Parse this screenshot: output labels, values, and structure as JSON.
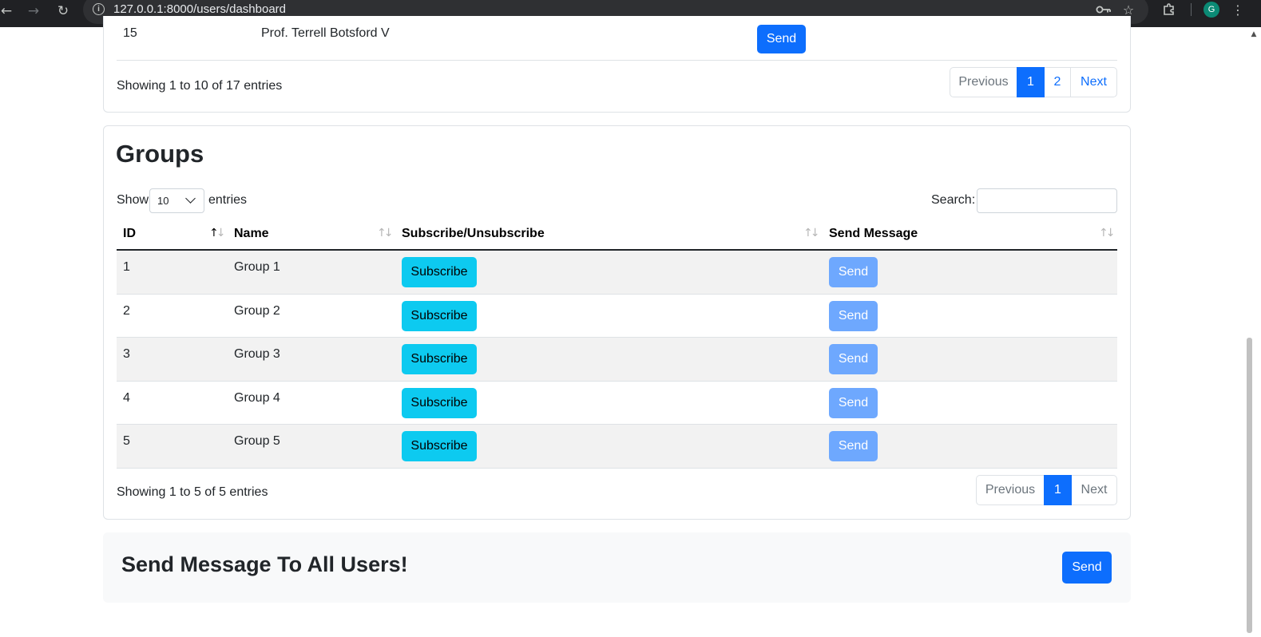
{
  "browser": {
    "url": "127.0.0.1:8000/users/dashboard",
    "profile_initial": "G"
  },
  "users_table": {
    "last_row": {
      "id": "15",
      "name": "Prof. Terrell Botsford V",
      "action_label": "Send"
    },
    "info": "Showing 1 to 10 of 17 entries",
    "pagination": {
      "previous": "Previous",
      "pages": [
        "1",
        "2"
      ],
      "active_page": "1",
      "next": "Next"
    }
  },
  "groups": {
    "title": "Groups",
    "length_menu": {
      "show_label": "Show",
      "selected": "10",
      "entries_label": "entries"
    },
    "search_label": "Search:",
    "columns": [
      "ID",
      "Name",
      "Subscribe/Unsubscribe",
      "Send Message"
    ],
    "rows": [
      {
        "id": "1",
        "name": "Group 1",
        "subscribe_label": "Subscribe",
        "send_label": "Send"
      },
      {
        "id": "2",
        "name": "Group 2",
        "subscribe_label": "Subscribe",
        "send_label": "Send"
      },
      {
        "id": "3",
        "name": "Group 3",
        "subscribe_label": "Subscribe",
        "send_label": "Send"
      },
      {
        "id": "4",
        "name": "Group 4",
        "subscribe_label": "Subscribe",
        "send_label": "Send"
      },
      {
        "id": "5",
        "name": "Group 5",
        "subscribe_label": "Subscribe",
        "send_label": "Send"
      }
    ],
    "info": "Showing 1 to 5 of 5 entries",
    "pagination": {
      "previous": "Previous",
      "pages": [
        "1"
      ],
      "active_page": "1",
      "next": "Next"
    }
  },
  "send_all": {
    "title": "Send Message To All Users!",
    "button_label": "Send"
  },
  "colors": {
    "primary": "#0d6efd",
    "info": "#0dcaf0",
    "disabled_primary": "#6ea8fe",
    "stripe": "#f2f2f2",
    "chrome": "#202124"
  }
}
